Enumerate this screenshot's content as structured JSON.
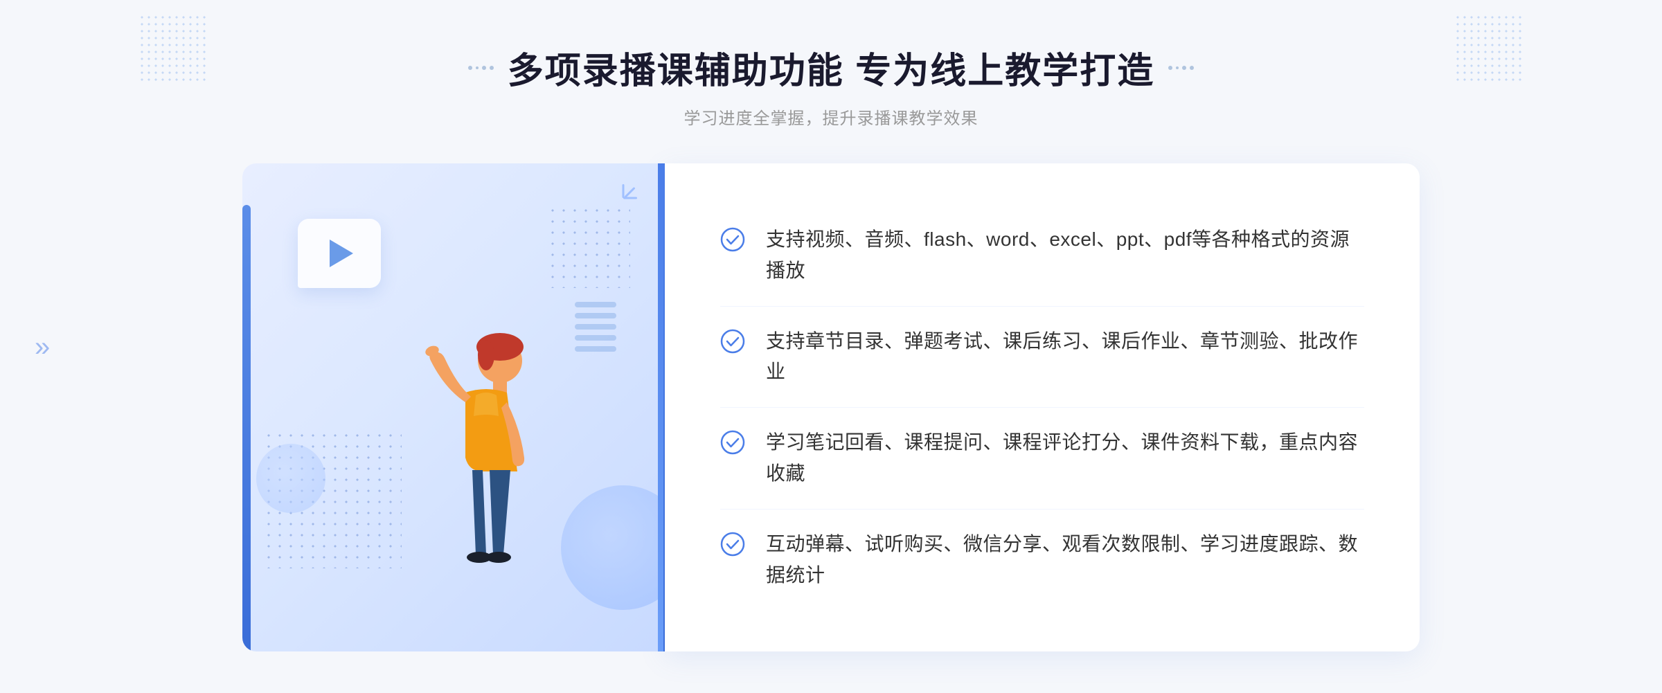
{
  "page": {
    "background_color": "#f5f7fb"
  },
  "header": {
    "title": "多项录播课辅助功能 专为线上教学打造",
    "subtitle": "学习进度全掌握，提升录播课教学效果",
    "title_deco_left": "decorative-dots",
    "title_deco_right": "decorative-dots"
  },
  "features": [
    {
      "id": 1,
      "text": "支持视频、音频、flash、word、excel、ppt、pdf等各种格式的资源播放",
      "icon": "check-circle"
    },
    {
      "id": 2,
      "text": "支持章节目录、弹题考试、课后练习、课后作业、章节测验、批改作业",
      "icon": "check-circle"
    },
    {
      "id": 3,
      "text": "学习笔记回看、课程提问、课程评论打分、课件资料下载，重点内容收藏",
      "icon": "check-circle"
    },
    {
      "id": 4,
      "text": "互动弹幕、试听购买、微信分享、观看次数限制、学习进度跟踪、数据统计",
      "icon": "check-circle"
    }
  ],
  "illustration": {
    "play_button": "▶",
    "accent_color": "#4a7de8"
  },
  "colors": {
    "primary_blue": "#4a7de8",
    "light_blue": "#6a9df8",
    "text_dark": "#1a1a2e",
    "text_gray": "#333",
    "text_light": "#999",
    "bg_main": "#f5f7fb",
    "bg_illus": "#dce8ff",
    "white": "#ffffff"
  }
}
